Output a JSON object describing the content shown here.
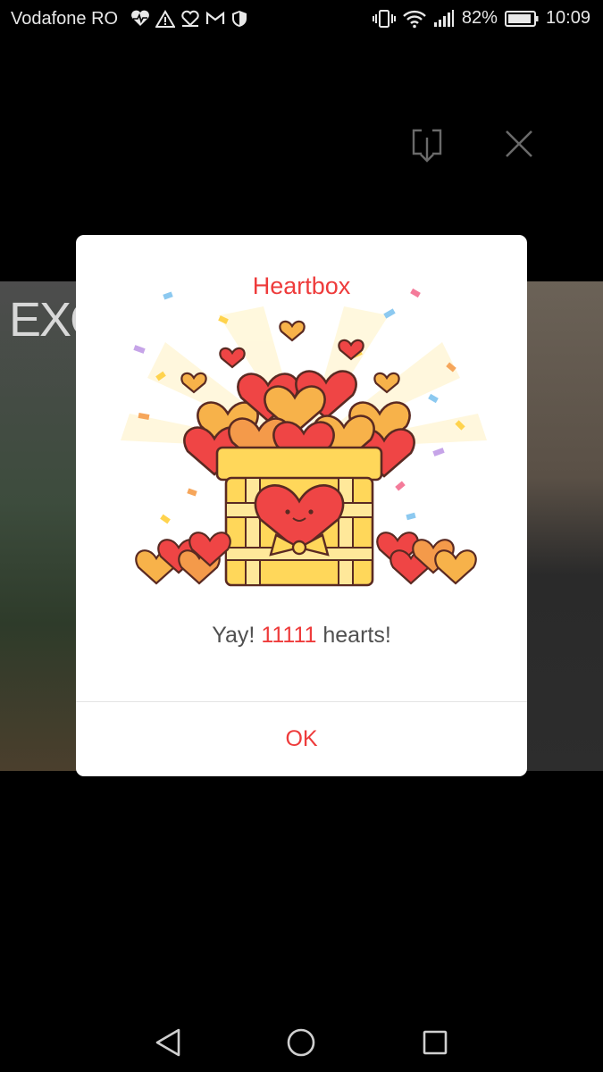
{
  "status_bar": {
    "carrier": "Vodafone RO",
    "battery": "82%",
    "time": "10:09",
    "icons": [
      "heart-rate-icon",
      "warning-icon",
      "heart-outline-icon",
      "mail-icon",
      "shield-icon",
      "vibrate-icon",
      "wifi-icon",
      "signal-icon",
      "battery-icon"
    ]
  },
  "photo": {
    "overlay_text": "EXC"
  },
  "dialog": {
    "title": "Heartbox",
    "message_prefix": "Yay! ",
    "heart_count": "11111",
    "message_suffix": " hearts!",
    "ok_label": "OK",
    "accent_color": "#ee3b3b"
  },
  "nav": {
    "icons": [
      "back-icon",
      "home-icon",
      "recent-apps-icon"
    ]
  }
}
